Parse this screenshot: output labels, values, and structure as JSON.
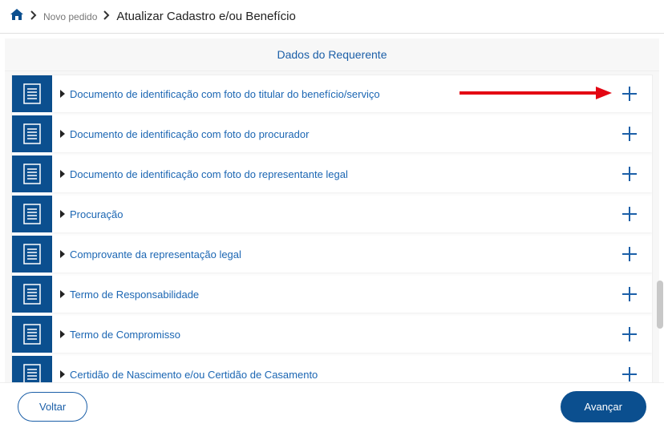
{
  "breadcrumb": {
    "link1": "Novo pedido",
    "current": "Atualizar Cadastro e/ou Benefício"
  },
  "section": {
    "title": "Dados do Requerente"
  },
  "documents": [
    {
      "label": "Documento de identificação com foto do titular do benefício/serviço"
    },
    {
      "label": "Documento de identificação com foto do procurador"
    },
    {
      "label": "Documento de identificação com foto do representante legal"
    },
    {
      "label": "Procuração"
    },
    {
      "label": "Comprovante da representação legal"
    },
    {
      "label": "Termo de Responsabilidade"
    },
    {
      "label": "Termo de Compromisso"
    },
    {
      "label": "Certidão de Nascimento e/ou Certidão de Casamento"
    }
  ],
  "buttons": {
    "back": "Voltar",
    "forward": "Avançar"
  },
  "colors": {
    "primary": "#0b4f8f",
    "link": "#1b66b3"
  }
}
